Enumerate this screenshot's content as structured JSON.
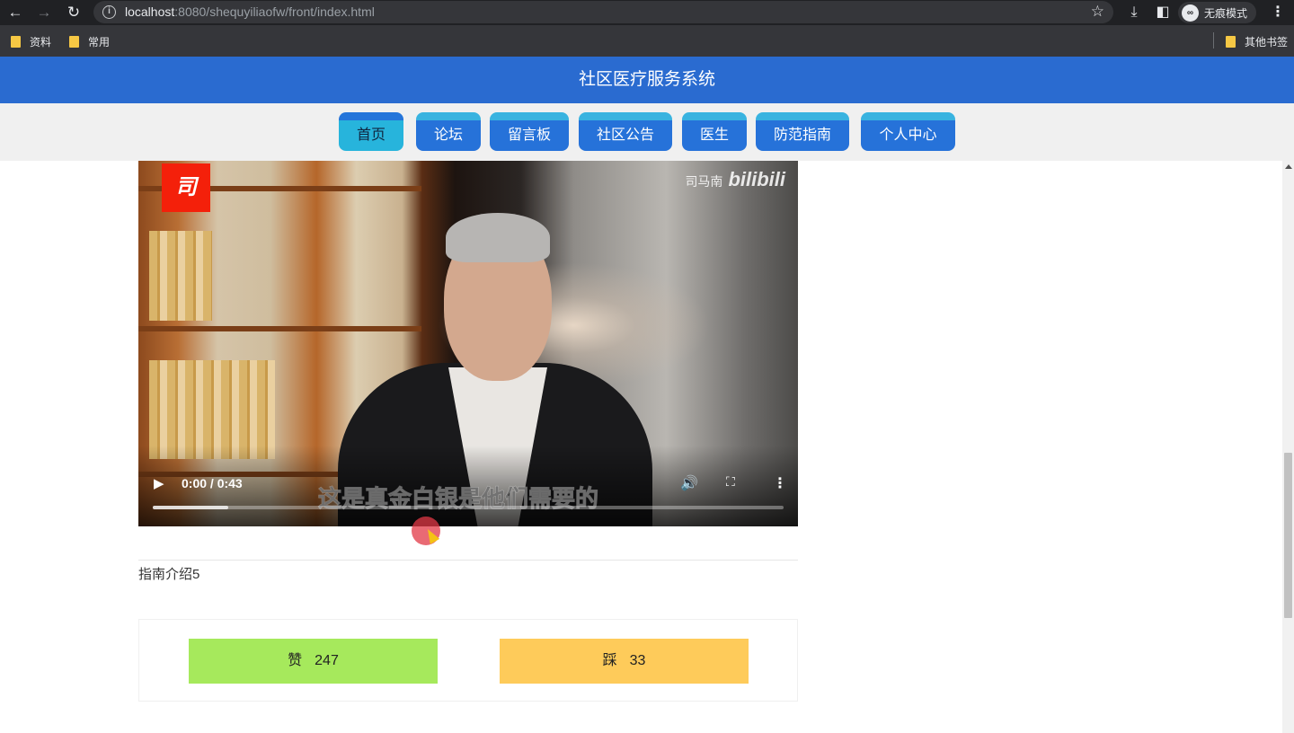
{
  "browser": {
    "url_host": "localhost",
    "url_rest": ":8080/shequyiliaofw/front/index.html",
    "incognito_label": "无痕模式",
    "bookmarks": [
      "资料",
      "常用"
    ],
    "other_bookmarks": "其他书签"
  },
  "site": {
    "title": "社区医疗服务系统",
    "nav": [
      {
        "label": "首页",
        "active": true
      },
      {
        "label": "论坛"
      },
      {
        "label": "留言板"
      },
      {
        "label": "社区公告"
      },
      {
        "label": "医生"
      },
      {
        "label": "防范指南"
      },
      {
        "label": "个人中心"
      }
    ]
  },
  "video": {
    "logo_text": "司",
    "watermark_name": "司马南",
    "watermark_brand": "bilibili",
    "subtitle": "这是真金白银是他们需要的",
    "time": "0:00 / 0:43",
    "buffered_fraction": 0.12
  },
  "content": {
    "guide_intro": "指南介绍5"
  },
  "votes": {
    "like_label": "赞",
    "like_count": "247",
    "dislike_label": "踩",
    "dislike_count": "33"
  }
}
